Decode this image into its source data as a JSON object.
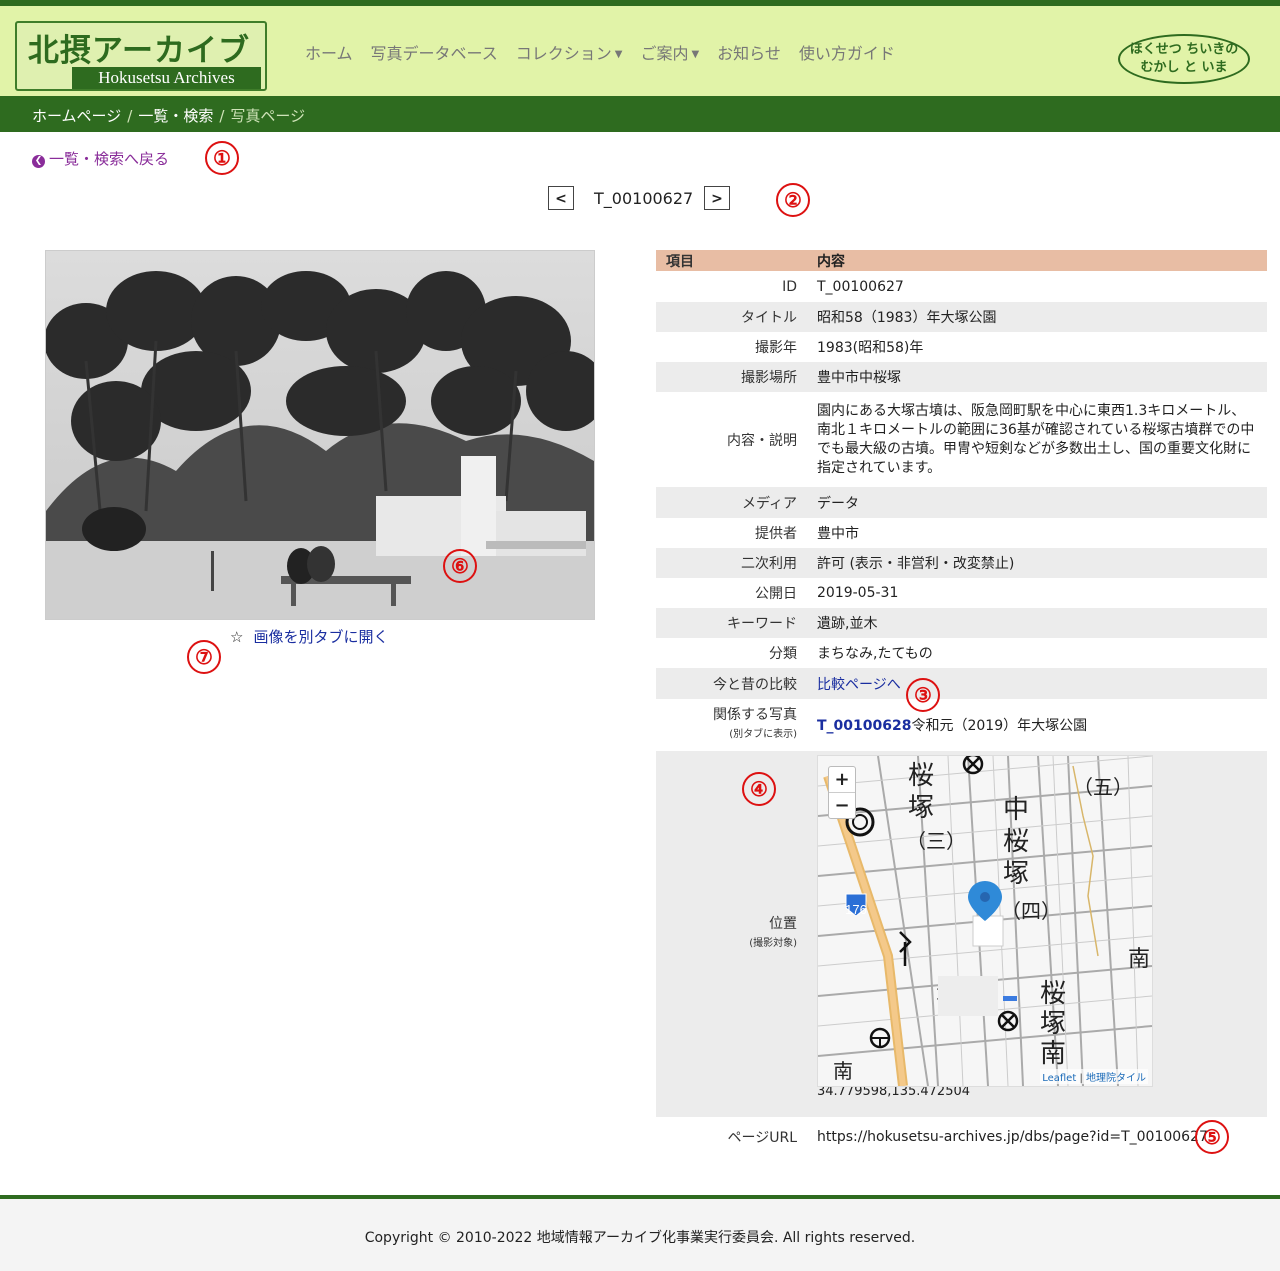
{
  "header": {
    "logo_ja": "北摂アーカイブス",
    "logo_en": "Hokusetsu Archives",
    "nav": [
      "ホーム",
      "写真データベース",
      "コレクション",
      "ご案内",
      "お知らせ",
      "使い方ガイド"
    ],
    "badge_line1": "ほくせつ ちいきの",
    "badge_line2": "むかし と いま"
  },
  "breadcrumb": {
    "home": "ホームページ",
    "list": "一覧・検索",
    "current": "写真ページ"
  },
  "back_link": "一覧・検索へ戻る",
  "pager": {
    "prev": "<",
    "next": ">",
    "id": "T_00100627"
  },
  "markers": [
    "①",
    "②",
    "③",
    "④",
    "⑤",
    "⑥",
    "⑦"
  ],
  "image_open_link": "画像を別タブに開く",
  "star_icon": "☆",
  "table": {
    "header_key": "項目",
    "header_val": "内容",
    "rows": [
      {
        "k": "ID",
        "v": "T_00100627"
      },
      {
        "k": "タイトル",
        "v": "昭和58（1983）年大塚公園"
      },
      {
        "k": "撮影年",
        "v": "1983(昭和58)年"
      },
      {
        "k": "撮影場所",
        "v": "豊中市中桜塚"
      },
      {
        "k": "内容・説明",
        "v": "園内にある大塚古墳は、阪急岡町駅を中心に東西1.3キロメートル、南北１キロメートルの範囲に36基が確認されている桜塚古墳群での中でも最大級の古墳。甲冑や短剣などが多数出土し、国の重要文化財に指定されています。"
      },
      {
        "k": "メディア",
        "v": "データ"
      },
      {
        "k": "提供者",
        "v": "豊中市"
      },
      {
        "k": "二次利用",
        "v": "許可 (表示・非営利・改変禁止)"
      },
      {
        "k": "公開日",
        "v": "2019-05-31"
      },
      {
        "k": "キーワード",
        "v": "遺跡,並木"
      },
      {
        "k": "分類",
        "v": "まちなみ,たてもの"
      }
    ],
    "compare_key": "今と昔の比較",
    "compare_link": "比較ページへ",
    "related_key": "関係する写真",
    "related_sub": "(別タブに表示)",
    "related_link": "T_00100628",
    "related_text": "令和元（2019）年大塚公園",
    "location_key": "位置",
    "location_sub": "(撮影対象)",
    "coords": "34.779598,135.472504",
    "url_key": "ページURL",
    "url_val": "https://hokusetsu-archives.jp/dbs/page?id=T_00100627"
  },
  "map": {
    "zoom_in": "+",
    "zoom_out": "−",
    "labels": [
      "桜",
      "塚",
      "（三）",
      "中",
      "桜",
      "塚",
      "（四）",
      "（五）",
      "南",
      "桜",
      "塚",
      "南",
      "南",
      "176"
    ],
    "attrib_leaflet": "Leaflet",
    "attrib_sep": " | ",
    "attrib_tiles": "地理院タイル"
  },
  "footer": "Copyright © 2010-2022 地域情報アーカイブ化事業実行委員会. All rights reserved."
}
